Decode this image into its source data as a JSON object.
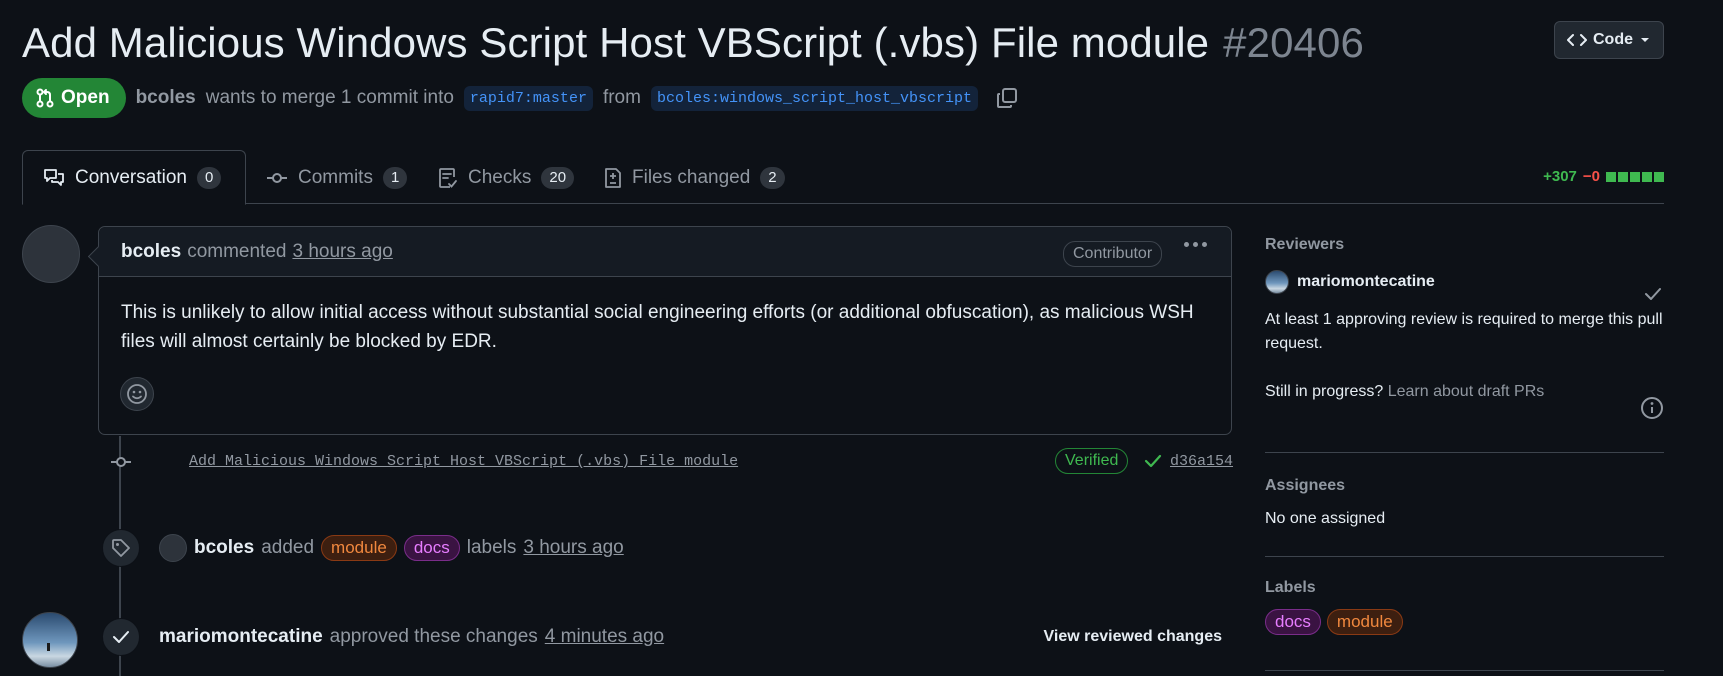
{
  "pr": {
    "title": "Add Malicious Windows Script Host VBScript (.vbs) File module",
    "number": "#20406",
    "state": "Open",
    "author": "bcoles",
    "merge_text_1": "wants to merge 1 commit into",
    "base_branch": "rapid7:master",
    "merge_text_2": "from",
    "head_branch": "bcoles:windows_script_host_vbscript"
  },
  "code_button": {
    "label": "Code"
  },
  "tabs": [
    {
      "label": "Conversation",
      "count": "0",
      "icon": "comment-discussion-icon"
    },
    {
      "label": "Commits",
      "count": "1",
      "icon": "git-commit-icon"
    },
    {
      "label": "Checks",
      "count": "20",
      "icon": "checklist-icon"
    },
    {
      "label": "Files changed",
      "count": "2",
      "icon": "file-diff-icon"
    }
  ],
  "diffstat": {
    "additions": "+307",
    "deletions": "−0"
  },
  "comment": {
    "author": "bcoles",
    "action": "commented",
    "time": "3 hours ago",
    "role": "Contributor",
    "body": "This is unlikely to allow initial access without substantial social engineering efforts (or additional obfuscation), as malicious WSH files will almost certainly be blocked by EDR."
  },
  "commit": {
    "message": "Add Malicious Windows Script Host VBScript (.vbs) File module",
    "verified": "Verified",
    "sha": "d36a154"
  },
  "label_event": {
    "author": "bcoles",
    "action": "added",
    "labels": [
      "module",
      "docs"
    ],
    "suffix": "labels",
    "time": "3 hours ago"
  },
  "review_event": {
    "author": "mariomontecatine",
    "action": "approved these changes",
    "time": "4 minutes ago",
    "view_label": "View reviewed changes"
  },
  "sidebar": {
    "reviewers": {
      "heading": "Reviewers",
      "name": "mariomontecatine",
      "note": "At least 1 approving review is required to merge this pull request.",
      "draft_q": "Still in progress?",
      "draft_link": "Learn about draft PRs"
    },
    "assignees": {
      "heading": "Assignees",
      "value": "No one assigned"
    },
    "labels": {
      "heading": "Labels",
      "items": [
        "docs",
        "module"
      ]
    }
  },
  "colors": {
    "background": "#0d1117",
    "open_green": "#238636",
    "link_blue": "#4493f8",
    "additions": "#3fb950",
    "deletions": "#f85149"
  }
}
